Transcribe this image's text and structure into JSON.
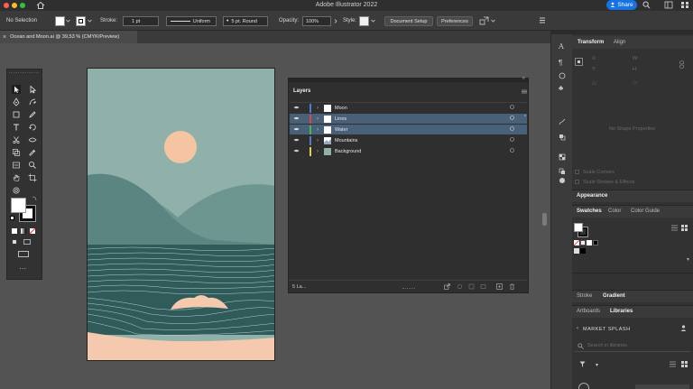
{
  "window": {
    "title": "Adobe Illustrator 2022",
    "share_label": "Share"
  },
  "controlbar": {
    "selection": "No Selection",
    "stroke_label": "Stroke:",
    "stroke_weight": "1 pt",
    "profile": "Uniform",
    "brush": "5 pt. Round",
    "opacity_label": "Opacity:",
    "opacity_value": "100%",
    "style_label": "Style:",
    "doc_setup": "Document Setup",
    "preferences": "Preferences"
  },
  "document": {
    "tab_title": "Ocean and Moon.ai @ 39,53 % (CMYK/Preview)"
  },
  "layers_panel": {
    "title": "Layers",
    "count": "5 La...",
    "layers": [
      {
        "name": "Moon",
        "color": "#4f7bd6",
        "selected": false
      },
      {
        "name": "Lines",
        "color": "#d6484f",
        "selected": true
      },
      {
        "name": "Water",
        "color": "#4fb34f",
        "selected": true
      },
      {
        "name": "Mountains",
        "color": "#4f7bd6",
        "selected": false
      },
      {
        "name": "Background",
        "color": "#e0d24f",
        "selected": false
      }
    ]
  },
  "right_panel": {
    "tabs_top": [
      "Transform",
      "Align"
    ],
    "no_shape": "No Shape Properties",
    "scale_corners": "Scale Corners",
    "scale_strokes": "Scale Strokes & Effects",
    "appearance": "Appearance",
    "tabs_swatches": [
      "Swatches",
      "Color",
      "Color Guide"
    ],
    "tabs_stroke": [
      "Stroke",
      "Gradient"
    ],
    "tabs_libraries": [
      "Artboards",
      "Libraries"
    ],
    "library_name": "MARKET SPLASH",
    "search_placeholder": "Search in libraries"
  },
  "colors": {
    "sky": "#8fb1aa",
    "moon": "#f5c5a3",
    "mountain_back": "#6e9690",
    "mountain_front": "#5a8580",
    "water": "#2f5b5a",
    "sand": "#f5c9ad",
    "accent": "#1473e6"
  }
}
